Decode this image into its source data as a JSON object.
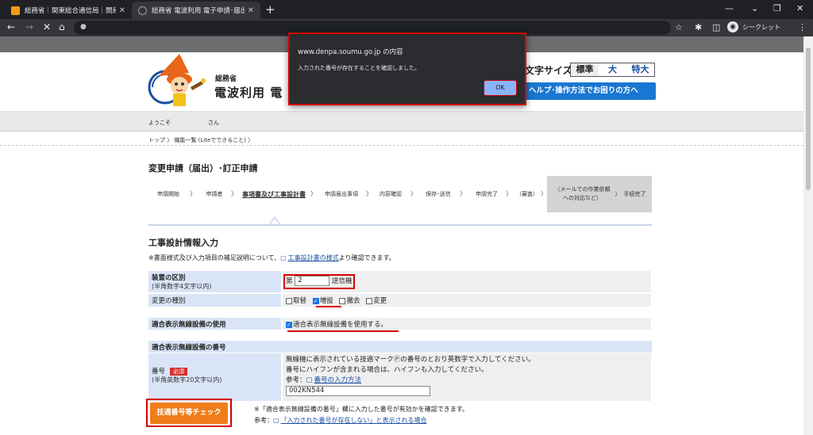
{
  "browser": {
    "tabs": [
      {
        "title": "総務省｜関東総合通信局｜開局・",
        "active": false
      },
      {
        "title": "総務省 電波利用 電子申請･届出:",
        "active": true
      }
    ],
    "close_glyph": "✕",
    "new_tab_glyph": "+",
    "incognito_label": "シークレット",
    "accent": "#8ab4f8"
  },
  "dialog": {
    "title": "www.denpa.soumu.go.jp の内容",
    "message": "入力された番号が存在することを確認しました。",
    "ok_label": "OK"
  },
  "header": {
    "ministry": "総務省",
    "system_title": "電波利用 電",
    "font_size_label": "文字サイズ",
    "font_sizes": [
      "標準",
      "大",
      "特大"
    ],
    "help_label": "ヘルプ･操作方法でお困りの方へ"
  },
  "welcome": {
    "greeting": "ようこそ",
    "suffix": "さん"
  },
  "breadcrumb": "トップ 〉 機能一覧 (Liteでできること) 〉",
  "page_title": "変更申請（届出）･訂正申請",
  "steps": [
    "申請開始",
    "申請者",
    "事項書及び工事設計書",
    "申請届出事項",
    "内容確認",
    "保存･送信",
    "申請完了",
    "（審査）",
    "（メールでの作業依頼への対応など）",
    "手続完了"
  ],
  "step_arrow": "〉",
  "section_title": "工事設計情報入力",
  "note": {
    "prefix": "※書面様式及び入力項目の補足説明について、",
    "link": "工事設計書の様式",
    "suffix": "より確認できます。"
  },
  "form": {
    "device_label": "装置の区別",
    "device_sub": "(半角数字4文字以内)",
    "device_prefix": "第",
    "device_value": "2",
    "device_suffix": "送信機",
    "change_label": "変更の種別",
    "change_options": [
      {
        "label": "取替",
        "checked": false
      },
      {
        "label": "増設",
        "checked": true
      },
      {
        "label": "撤去",
        "checked": false
      },
      {
        "label": "変更",
        "checked": false
      }
    ],
    "conform_use_label": "適合表示無線設備の使用",
    "conform_use_option": "適合表示無線設備を使用する。",
    "conform_number_section": "適合表示無線設備の番号",
    "number_label": "番号",
    "required_badge": "必須",
    "number_sub": "(半角英数字20文字以内)",
    "number_help1": "無線機に表示されている技適マーク",
    "number_help1b": "の番号のとおり英数字で入力してください。",
    "number_help2": "番号にハイフンが含まれる場合は、ハイフンも入力してください。",
    "number_ref_prefix": "参考：",
    "number_ref_link": "番号の入力方法",
    "number_value": "002KN544"
  },
  "check_button": "技適番号等チェック",
  "footer": {
    "note": "※「適合表示無線設備の番号」欄に入力した番号が有効かを確認できます。",
    "ref_prefix": "参考：",
    "ref_link": "「入力された番号が存在しない」と表示される場合"
  }
}
